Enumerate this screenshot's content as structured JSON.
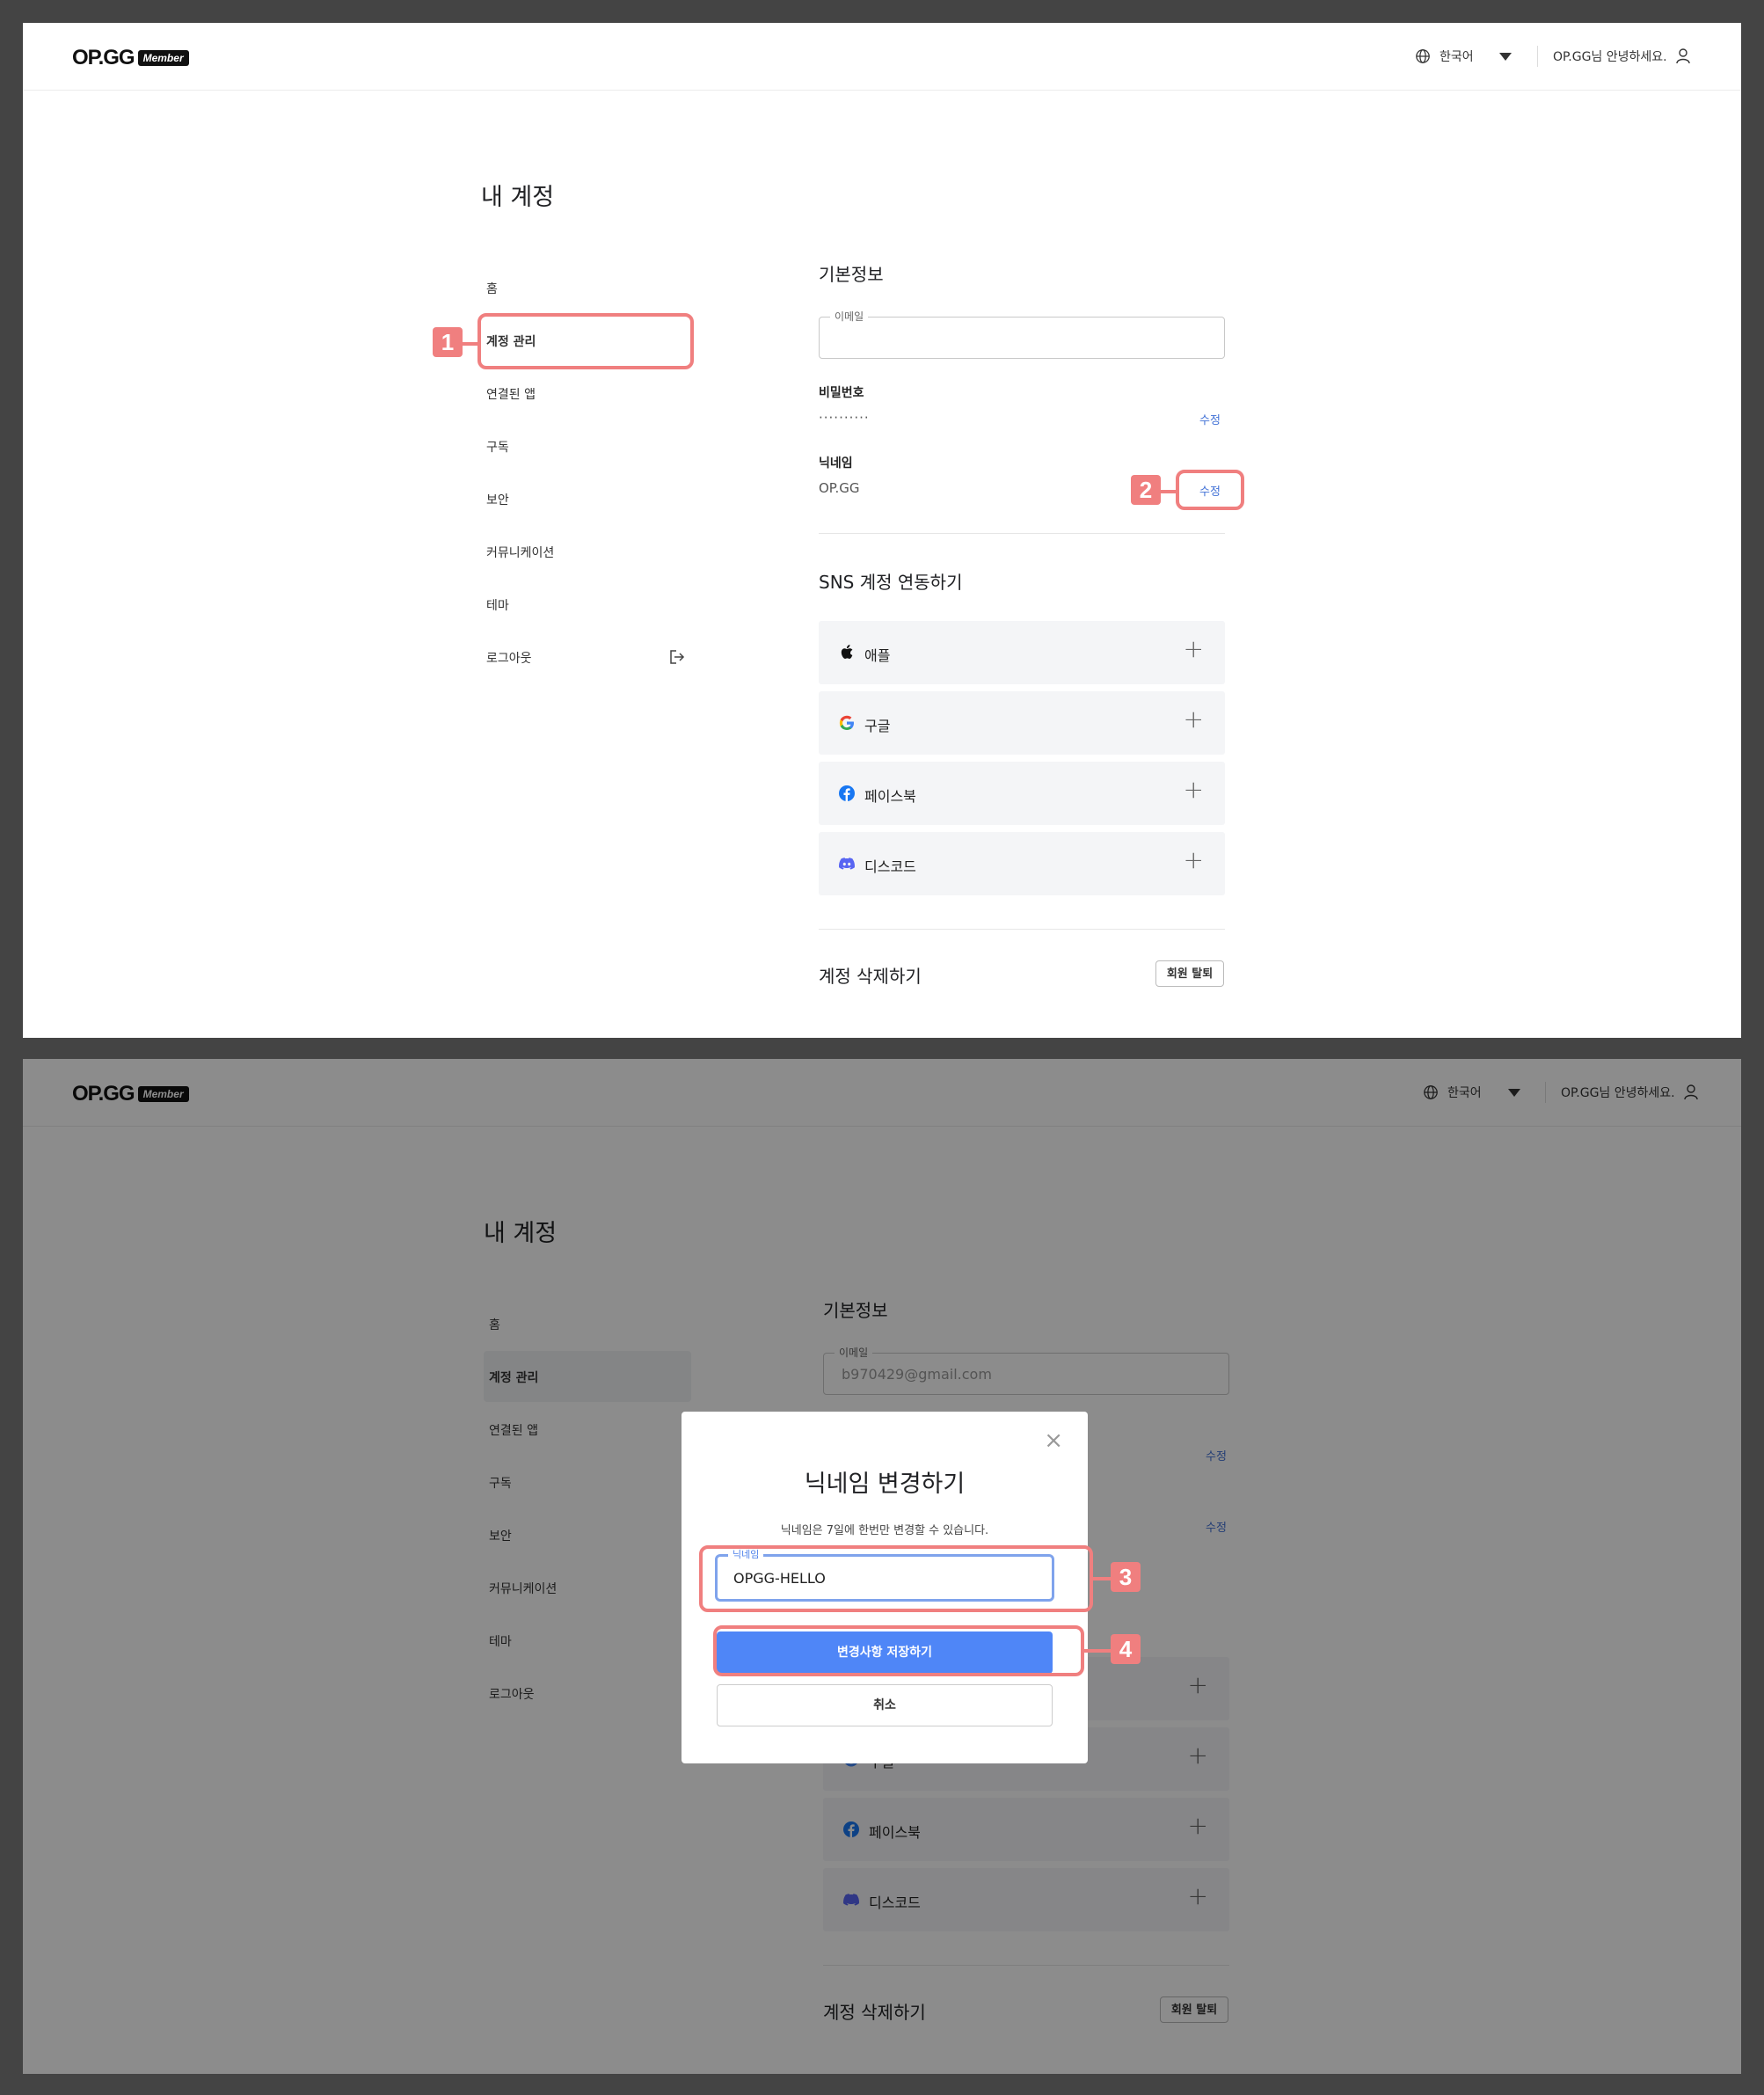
{
  "header": {
    "logo_text": "OP.GG",
    "logo_badge": "Member",
    "language": "한국어",
    "greeting": "OP.GG님 안녕하세요."
  },
  "page": {
    "title": "내 계정"
  },
  "sidebar": {
    "items": [
      {
        "label": "홈"
      },
      {
        "label": "계정 관리"
      },
      {
        "label": "연결된 앱"
      },
      {
        "label": "구독"
      },
      {
        "label": "보안"
      },
      {
        "label": "커뮤니케이션"
      },
      {
        "label": "테마"
      },
      {
        "label": "로그아웃"
      }
    ]
  },
  "basic_info": {
    "title": "기본정보",
    "email_label": "이메일",
    "email_value_first": "",
    "email_value_second": "b970429@gmail.com",
    "password_label": "비밀번호",
    "password_value": "··········",
    "nickname_label": "닉네임",
    "nickname_value": "OP.GG",
    "edit_label": "수정"
  },
  "sns": {
    "title": "SNS 계정 연동하기",
    "items": [
      {
        "name": "애플",
        "icon": "apple-icon"
      },
      {
        "name": "구글",
        "icon": "google-icon"
      },
      {
        "name": "페이스북",
        "icon": "facebook-icon"
      },
      {
        "name": "디스코드",
        "icon": "discord-icon"
      }
    ],
    "add_symbol": "+"
  },
  "delete_account": {
    "title": "계정 삭제하기",
    "button": "회원 탈퇴"
  },
  "modal": {
    "title": "닉네임 변경하기",
    "description": "닉네임은 7일에 한번만 변경할 수 있습니다.",
    "field_label": "닉네임",
    "field_value": "OPGG-HELLO",
    "save_button": "변경사항 저장하기",
    "cancel_button": "취소",
    "close_symbol": "×"
  },
  "callouts": [
    "1",
    "2",
    "3",
    "4"
  ],
  "colors": {
    "accent_blue": "#4f86f7",
    "link_blue": "#4171d6",
    "callout_red": "#f07f7f"
  }
}
